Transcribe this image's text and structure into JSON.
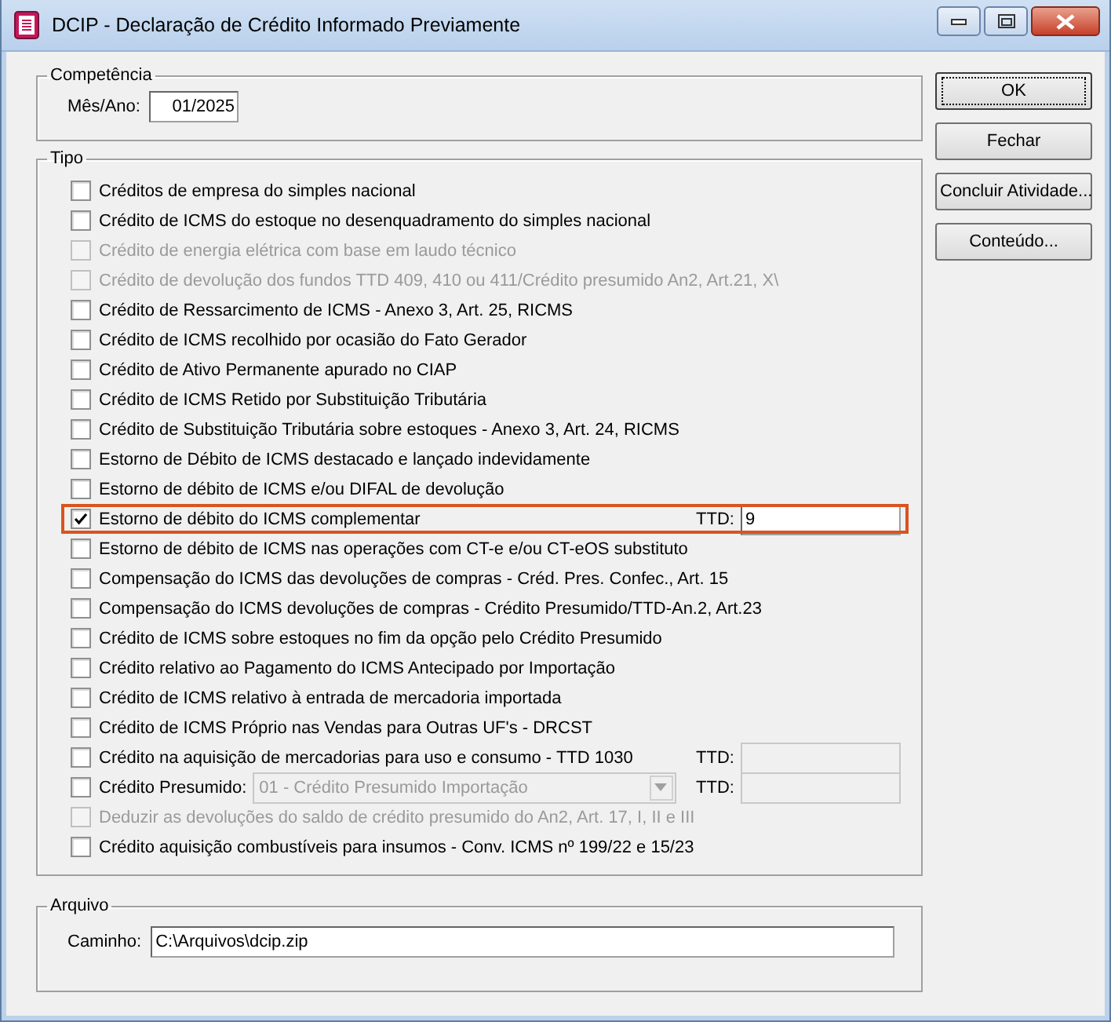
{
  "window": {
    "title": "DCIP - Declaração de Crédito Informado Previamente"
  },
  "competencia": {
    "title": "Competência",
    "label": "Mês/Ano:",
    "value": "01/2025"
  },
  "tipo": {
    "title": "Tipo",
    "items": [
      {
        "kind": "check",
        "label": "Créditos de empresa do simples nacional",
        "checked": false,
        "disabled": false,
        "highlighted": false
      },
      {
        "kind": "check",
        "label": "Crédito de ICMS do estoque no desenquadramento do simples nacional",
        "checked": false,
        "disabled": false,
        "highlighted": false
      },
      {
        "kind": "check",
        "label": "Crédito de energia elétrica com base em laudo técnico",
        "checked": false,
        "disabled": true,
        "highlighted": false
      },
      {
        "kind": "check",
        "label": "Crédito de devolução dos fundos TTD 409, 410 ou 411/Crédito presumido An2, Art.21, X\\",
        "checked": false,
        "disabled": true,
        "highlighted": false
      },
      {
        "kind": "check",
        "label": "Crédito de Ressarcimento de ICMS -  Anexo 3, Art. 25, RICMS",
        "checked": false,
        "disabled": false,
        "highlighted": false
      },
      {
        "kind": "check",
        "label": "Crédito de ICMS recolhido por ocasião do Fato Gerador",
        "checked": false,
        "disabled": false,
        "highlighted": false
      },
      {
        "kind": "check",
        "label": "Crédito de Ativo Permanente apurado no CIAP",
        "checked": false,
        "disabled": false,
        "highlighted": false
      },
      {
        "kind": "check",
        "label": "Crédito de ICMS Retido por Substituição Tributária",
        "checked": false,
        "disabled": false,
        "highlighted": false
      },
      {
        "kind": "check",
        "label": "Crédito de Substituição Tributária sobre estoques - Anexo 3, Art. 24, RICMS",
        "checked": false,
        "disabled": false,
        "highlighted": false
      },
      {
        "kind": "check",
        "label": "Estorno de Débito de ICMS destacado e lançado indevidamente",
        "checked": false,
        "disabled": false,
        "highlighted": false
      },
      {
        "kind": "check",
        "label": "Estorno de débito de ICMS e/ou DIFAL de devolução",
        "checked": false,
        "disabled": false,
        "highlighted": false
      },
      {
        "kind": "check_ttd",
        "label": "Estorno de débito do ICMS complementar",
        "checked": true,
        "disabled": false,
        "highlighted": true,
        "ttd_label": "TTD:",
        "ttd_value": "9",
        "ttd_disabled": false
      },
      {
        "kind": "check",
        "label": "Estorno de débito de ICMS nas operações com CT-e e/ou CT-eOS substituto",
        "checked": false,
        "disabled": false,
        "highlighted": false
      },
      {
        "kind": "check",
        "label": "Compensação do ICMS das devoluções de compras - Créd. Pres. Confec., Art. 15",
        "checked": false,
        "disabled": false,
        "highlighted": false
      },
      {
        "kind": "check",
        "label": "Compensação do ICMS devoluções de compras - Crédito Presumido/TTD-An.2, Art.23",
        "checked": false,
        "disabled": false,
        "highlighted": false
      },
      {
        "kind": "check",
        "label": "Crédito de ICMS sobre estoques no fim da opção pelo Crédito Presumido",
        "checked": false,
        "disabled": false,
        "highlighted": false
      },
      {
        "kind": "check",
        "label": "Crédito relativo ao Pagamento do ICMS Antecipado por Importação",
        "checked": false,
        "disabled": false,
        "highlighted": false
      },
      {
        "kind": "check",
        "label": "Crédito de ICMS relativo à entrada de mercadoria importada",
        "checked": false,
        "disabled": false,
        "highlighted": false
      },
      {
        "kind": "check",
        "label": "Crédito de ICMS Próprio nas Vendas para Outras UF's - DRCST",
        "checked": false,
        "disabled": false,
        "highlighted": false
      },
      {
        "kind": "check_ttd",
        "label": "Crédito na aquisição de mercadorias para uso e consumo - TTD 1030",
        "checked": false,
        "disabled": false,
        "highlighted": false,
        "ttd_label": "TTD:",
        "ttd_disabled": true
      },
      {
        "kind": "check_select",
        "label": "Crédito Presumido:",
        "checked": false,
        "disabled": false,
        "highlighted": false,
        "select_value": "01 - Crédito Presumido Importação",
        "select_disabled": true,
        "ttd_label": "TTD:",
        "ttd_disabled": true
      },
      {
        "kind": "check",
        "label": "Deduzir as devoluções do saldo de crédito presumido do An2, Art. 17, I, II e III",
        "checked": false,
        "disabled": true,
        "highlighted": false
      },
      {
        "kind": "check",
        "label": "Crédito aquisição combustíveis para insumos - Conv. ICMS nº 199/22 e 15/23",
        "checked": false,
        "disabled": false,
        "highlighted": false
      }
    ]
  },
  "arquivo": {
    "title": "Arquivo",
    "label": "Caminho:",
    "value": "C:\\Arquivos\\dcip.zip"
  },
  "buttons": [
    {
      "label": "OK",
      "default": true
    },
    {
      "label": "Fechar",
      "default": false
    },
    {
      "label": "Concluir Atividade...",
      "default": false
    },
    {
      "label": "Conteúdo...",
      "default": false
    }
  ]
}
